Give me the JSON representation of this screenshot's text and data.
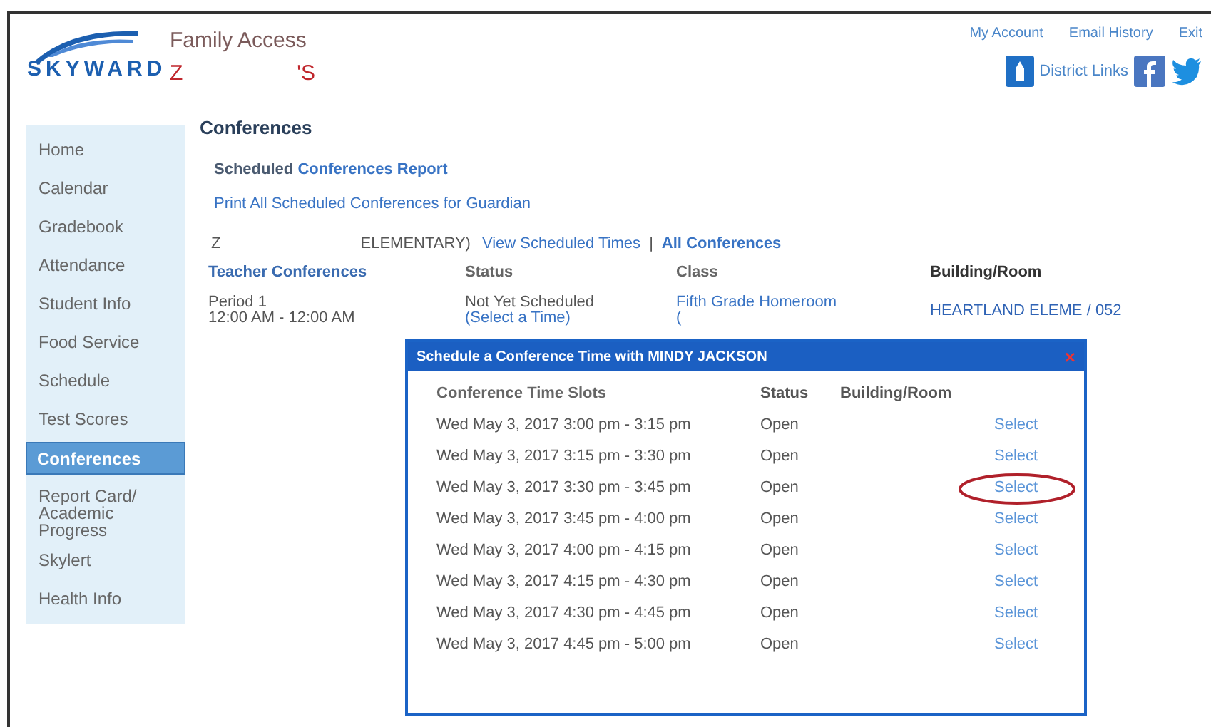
{
  "header": {
    "logo": "SKYWARD",
    "app_title": "Family Access",
    "student_name_parts": [
      "Z",
      "'S"
    ],
    "top_links": [
      "My Account",
      "Email History",
      "Exit"
    ],
    "district_links": "District Links"
  },
  "sidebar": {
    "items": [
      {
        "label": "Home",
        "selected": false
      },
      {
        "label": "Calendar",
        "selected": false
      },
      {
        "label": "Gradebook",
        "selected": false
      },
      {
        "label": "Attendance",
        "selected": false
      },
      {
        "label": "Student Info",
        "selected": false
      },
      {
        "label": "Food Service",
        "selected": false
      },
      {
        "label": "Schedule",
        "selected": false
      },
      {
        "label": "Test Scores",
        "selected": false
      },
      {
        "label": "Conferences",
        "selected": true
      },
      {
        "label": "Report Card/ Academic Progress",
        "selected": false
      },
      {
        "label": "Skylert",
        "selected": false
      },
      {
        "label": "Health Info",
        "selected": false
      }
    ]
  },
  "page_title": "Conferences",
  "report": {
    "prefix": "Scheduled",
    "link": "Conferences Report"
  },
  "print_link": "Print All Scheduled Conferences for Guardian",
  "school_row": {
    "student": "Z",
    "school": "ELEMENTARY)",
    "view_link": "View Scheduled Times",
    "separator": "|",
    "all_link": "All Conferences"
  },
  "table": {
    "columns": [
      "Teacher Conferences",
      "Status",
      "Class",
      "Building/Room"
    ],
    "rows": [
      {
        "period": "Period 1",
        "time": "12:00 AM - 12:00 AM",
        "status": "Not Yet Scheduled",
        "select_link": "(Select a Time)",
        "class": "Fifth Grade Homeroom",
        "class_extra": "(",
        "room": "HEARTLAND ELEME / 052"
      }
    ]
  },
  "dialog": {
    "title": "Schedule a Conference Time with MINDY JACKSON",
    "close": "×",
    "columns": [
      "Conference Time Slots",
      "Status",
      "Building/Room"
    ],
    "slots": [
      {
        "time": "Wed May 3, 2017 3:00 pm - 3:15 pm",
        "status": "Open",
        "action": "Select",
        "circled": false
      },
      {
        "time": "Wed May 3, 2017 3:15 pm - 3:30 pm",
        "status": "Open",
        "action": "Select",
        "circled": false
      },
      {
        "time": "Wed May 3, 2017 3:30 pm - 3:45 pm",
        "status": "Open",
        "action": "Select",
        "circled": true
      },
      {
        "time": "Wed May 3, 2017 3:45 pm - 4:00 pm",
        "status": "Open",
        "action": "Select",
        "circled": false
      },
      {
        "time": "Wed May 3, 2017 4:00 pm - 4:15 pm",
        "status": "Open",
        "action": "Select",
        "circled": false
      },
      {
        "time": "Wed May 3, 2017 4:15 pm - 4:30 pm",
        "status": "Open",
        "action": "Select",
        "circled": false
      },
      {
        "time": "Wed May 3, 2017 4:30 pm - 4:45 pm",
        "status": "Open",
        "action": "Select",
        "circled": false
      },
      {
        "time": "Wed May 3, 2017 4:45 pm - 5:00 pm",
        "status": "Open",
        "action": "Select",
        "circled": false
      }
    ]
  }
}
